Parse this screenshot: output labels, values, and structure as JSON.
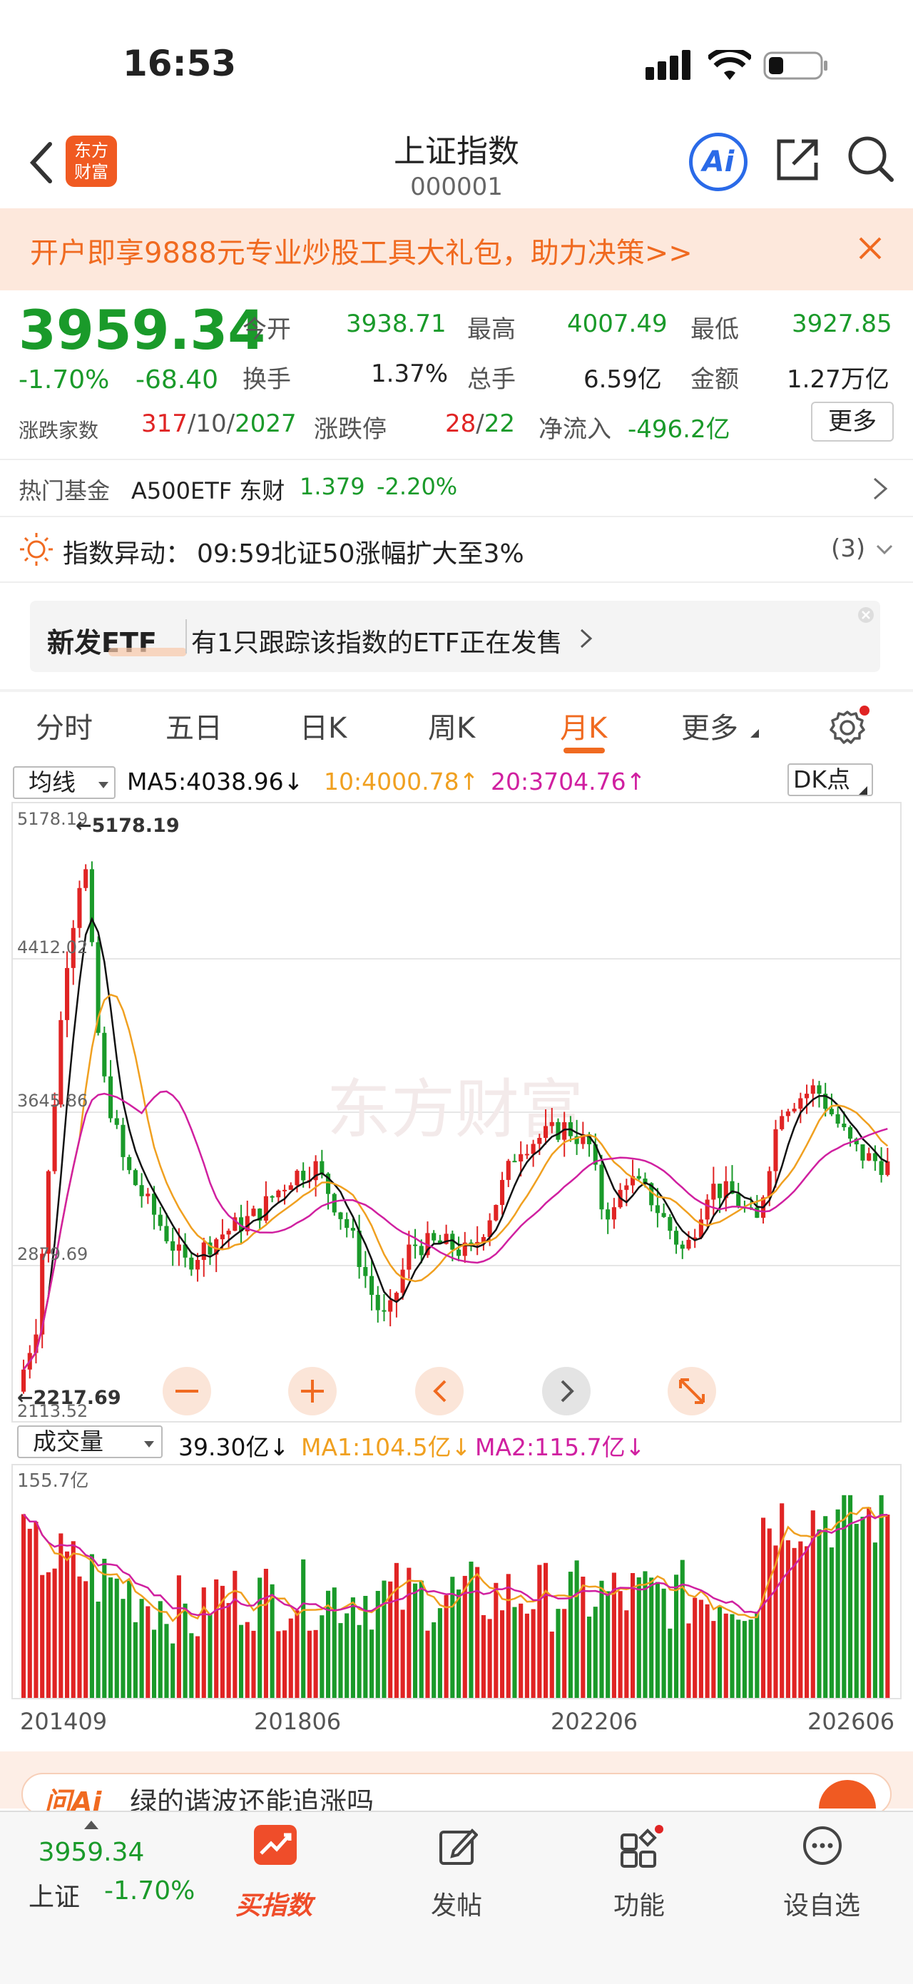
{
  "status_bar": {
    "time": "16:53"
  },
  "header": {
    "title": "上证指数",
    "code": "000001",
    "logo_text_1": "东方",
    "logo_text_2": "财富",
    "ai_label": "Ai"
  },
  "banner": {
    "text": "开户即享9888元专业炒股工具大礼包，助力决策>>"
  },
  "quote": {
    "price": "3959.34",
    "change_pct": "-1.70%",
    "change": "-68.40",
    "open_label": "今开",
    "open": "3938.71",
    "high_label": "最高",
    "high": "4007.49",
    "low_label": "最低",
    "low": "3927.85",
    "turnover_label": "换手",
    "turnover": "1.37%",
    "volume_label": "总手",
    "volume": "6.59亿",
    "amount_label": "金额",
    "amount": "1.27万亿",
    "breadth_label": "涨跌家数",
    "up_count": "317",
    "flat_count": "10",
    "down_count": "2027",
    "limit_label": "涨跌停",
    "limit_up": "28",
    "limit_down": "22",
    "inflow_label": "净流入",
    "inflow": "-496.2亿",
    "more_label": "更多",
    "sep": "/"
  },
  "fund": {
    "label": "热门基金",
    "name": "A500ETF 东财",
    "price": "1.379",
    "change": "-2.20%"
  },
  "alert": {
    "label": "指数异动：",
    "text": "09:59北证50涨幅扩大至3%",
    "count": "(3)"
  },
  "etf_card": {
    "title": "新发ETF",
    "text": "有1只跟踪该指数的ETF正在发售"
  },
  "tabs": [
    {
      "label": "分时"
    },
    {
      "label": "五日"
    },
    {
      "label": "日K"
    },
    {
      "label": "周K"
    },
    {
      "label": "月K"
    },
    {
      "label": "更多"
    }
  ],
  "indicator": {
    "select": "均线",
    "ma5": "MA5:4038.96↓",
    "ma10": "10:4000.78↑",
    "ma20": "20:3704.76↑",
    "dk": "DK点"
  },
  "chart_labels": {
    "y_max": "5178.19",
    "y_1": "4412.02",
    "y_2": "3645.86",
    "y_3": "2879.69",
    "y_min": "2113.52",
    "max_marker": "←5178.19",
    "min_marker": "←2217.69",
    "watermark": "东方财富"
  },
  "volume": {
    "select": "成交量",
    "current": "39.30亿↓",
    "ma1": "MA1:104.5亿↓",
    "ma2": "MA2:115.7亿↓",
    "max": "155.7亿"
  },
  "dates": [
    "201409",
    "201806",
    "202206",
    "202606"
  ],
  "ai_strip": {
    "logo": "问Ai",
    "text": "绿的谐波还能追涨吗"
  },
  "bottom_nav": {
    "index_price": "3959.34",
    "index_name": "上证",
    "index_change": "-1.70%",
    "buy_label": "买指数",
    "post_label": "发帖",
    "func_label": "功能",
    "watch_label": "设自选"
  },
  "colors": {
    "up": "#e02424",
    "down": "#1a9a2a",
    "accent": "#f06a20",
    "ma5": "#111111",
    "ma10": "#f0a020",
    "ma20": "#d020a0"
  }
}
